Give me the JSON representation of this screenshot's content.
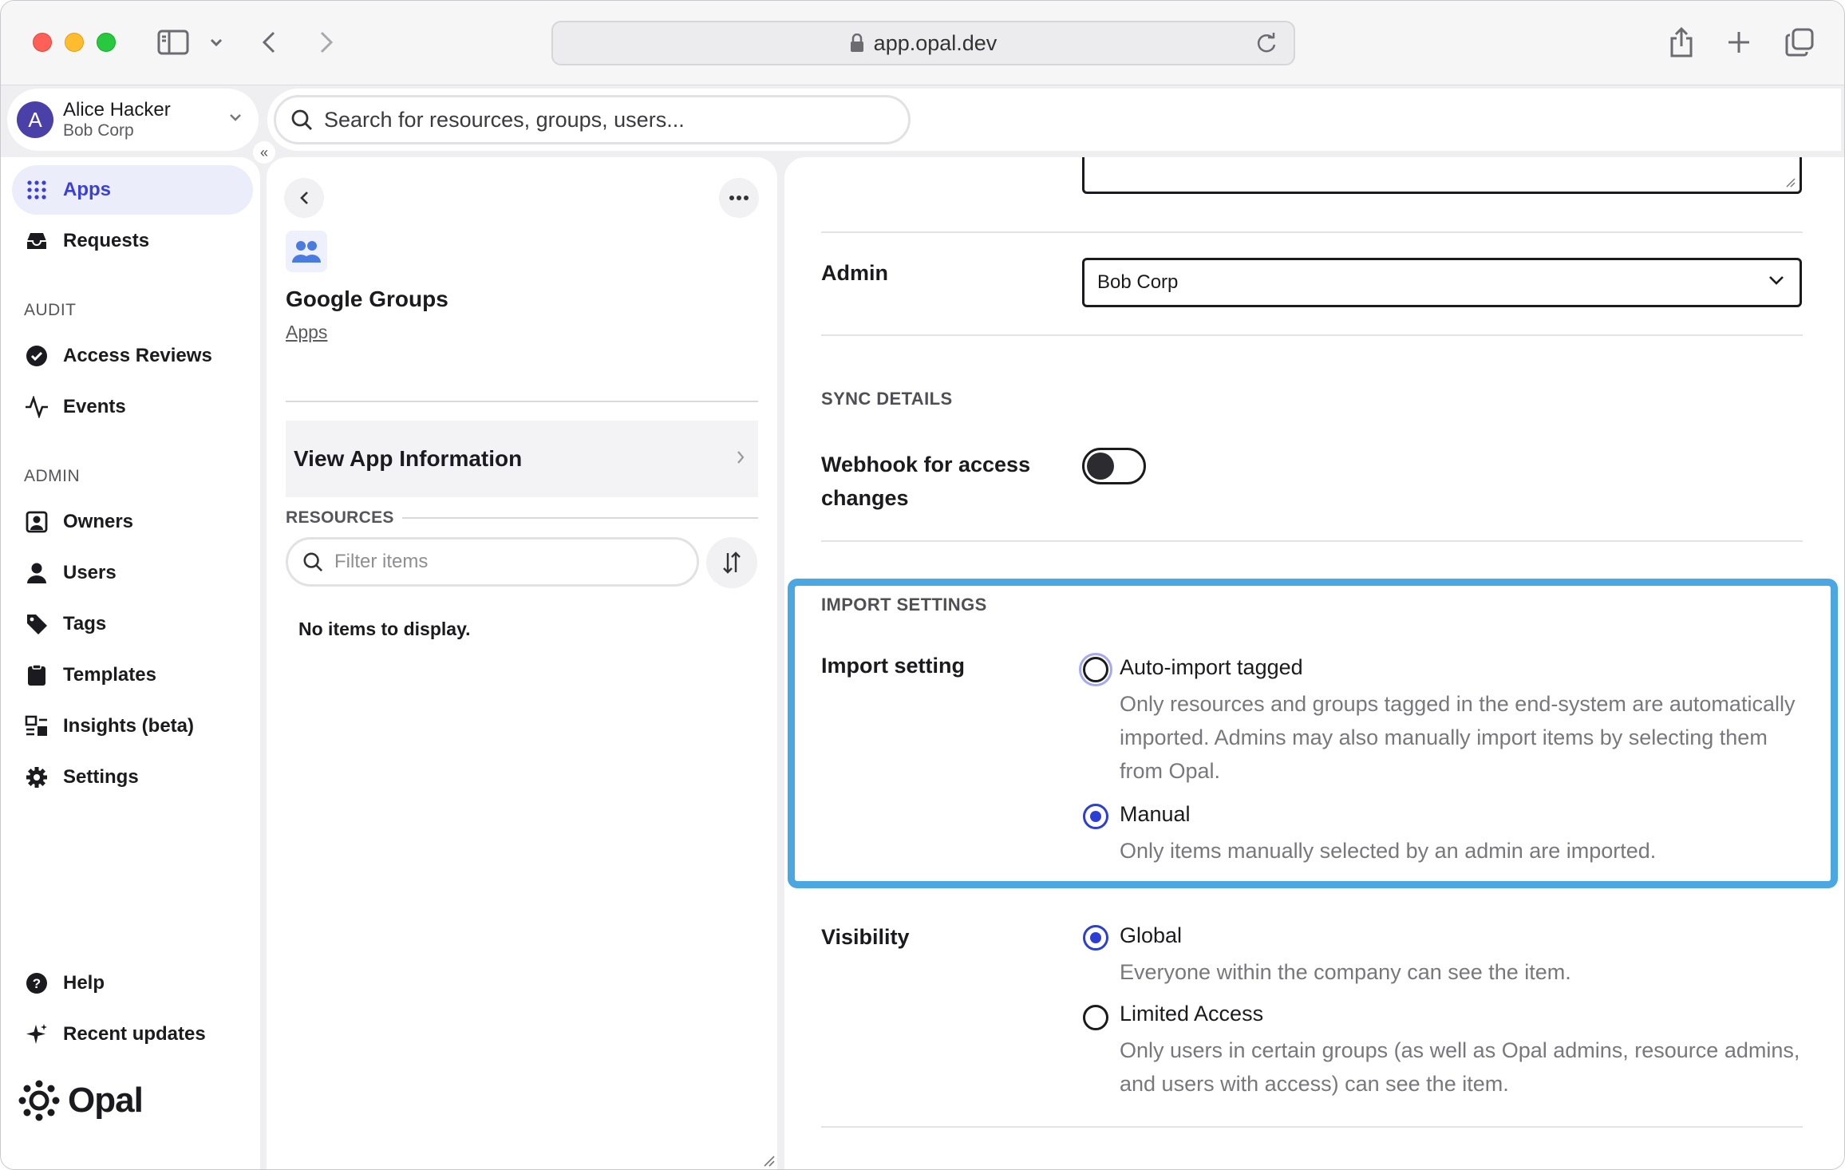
{
  "browser": {
    "url": "app.opal.dev"
  },
  "account": {
    "avatar_letter": "A",
    "name": "Alice Hacker",
    "org": "Bob Corp"
  },
  "search": {
    "placeholder": "Search for resources, groups, users..."
  },
  "sidebar": {
    "items_top": [
      {
        "label": "Apps",
        "icon": "apps-grid-icon",
        "active": true
      },
      {
        "label": "Requests",
        "icon": "inbox-icon"
      }
    ],
    "audit_label": "AUDIT",
    "audit_items": [
      {
        "label": "Access Reviews",
        "icon": "check-circle-icon"
      },
      {
        "label": "Events",
        "icon": "activity-icon"
      }
    ],
    "admin_label": "ADMIN",
    "admin_items": [
      {
        "label": "Owners",
        "icon": "owner-badge-icon"
      },
      {
        "label": "Users",
        "icon": "user-icon"
      },
      {
        "label": "Tags",
        "icon": "tag-icon"
      },
      {
        "label": "Templates",
        "icon": "clipboard-icon"
      },
      {
        "label": "Insights (beta)",
        "icon": "insights-icon"
      },
      {
        "label": "Settings",
        "icon": "gear-icon"
      }
    ],
    "bottom_items": [
      {
        "label": "Help",
        "icon": "help-icon"
      },
      {
        "label": "Recent updates",
        "icon": "sparkle-icon"
      }
    ],
    "logo_text": "Opal"
  },
  "app_panel": {
    "title": "Google Groups",
    "breadcrumb": "Apps",
    "view_info_label": "View App Information",
    "resources_label": "RESOURCES",
    "filter_placeholder": "Filter items",
    "empty_text": "No items to display."
  },
  "settings": {
    "admin_label": "Admin",
    "admin_value": "Bob Corp",
    "sync_section": "SYNC DETAILS",
    "webhook_label_line1": "Webhook for access",
    "webhook_label_line2": "changes",
    "webhook_enabled": false,
    "import_section": "IMPORT SETTINGS",
    "import_label": "Import setting",
    "import_options": [
      {
        "title": "Auto-import tagged",
        "desc": "Only resources and groups tagged in the end-system are automatically imported. Admins may also manually import items by selecting them from Opal.",
        "selected": false
      },
      {
        "title": "Manual",
        "desc": "Only items manually selected by an admin are imported.",
        "selected": true
      }
    ],
    "visibility_label": "Visibility",
    "visibility_options": [
      {
        "title": "Global",
        "desc": "Everyone within the company can see the item.",
        "selected": true
      },
      {
        "title": "Limited Access",
        "desc": "Only users in certain groups (as well as Opal admins, resource admins, and users with access) can see the item.",
        "selected": false
      }
    ]
  },
  "colors": {
    "accent": "#2d3fd3",
    "highlight_border": "#4aa7e1",
    "active_nav_bg": "#ecedfb"
  }
}
